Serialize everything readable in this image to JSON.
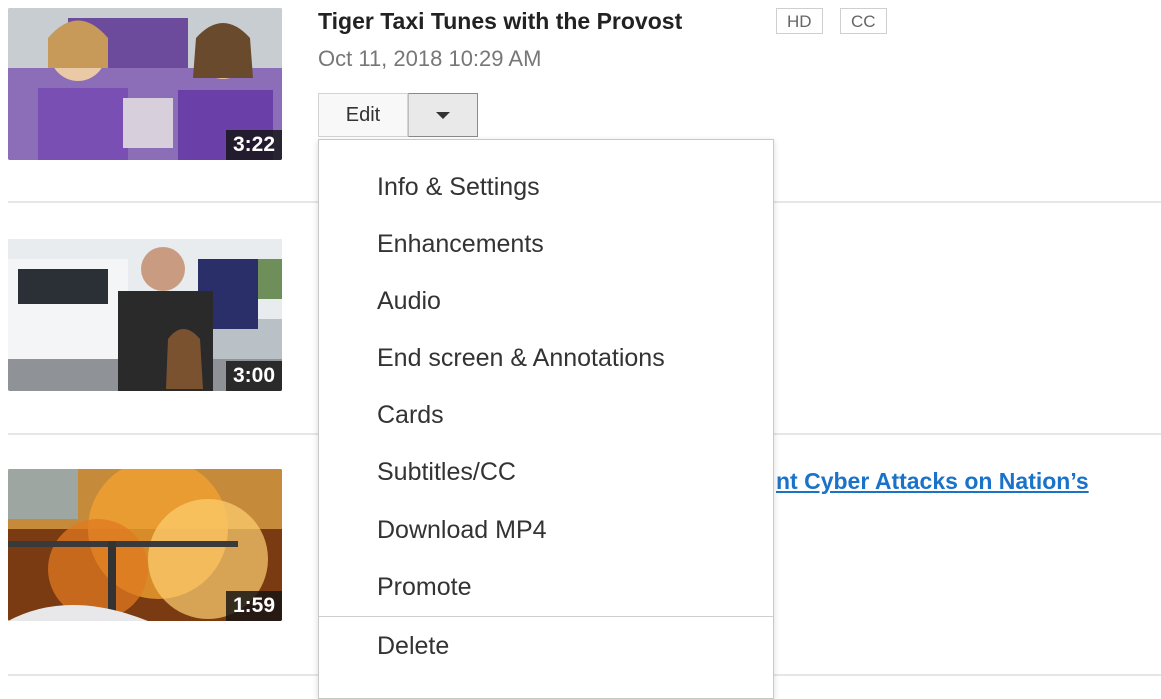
{
  "videos": [
    {
      "title": "Tiger Taxi Tunes with the Provost",
      "badges": [
        "HD",
        "CC"
      ],
      "date": "Oct 11, 2018 10:29 AM",
      "duration": "3:22"
    },
    {
      "duration": "3:00"
    },
    {
      "title_fragment": "nt Cyber Attacks on Nation’s",
      "duration": "1:59"
    }
  ],
  "edit": {
    "label": "Edit",
    "dropdown_icon": "chevron-down-icon"
  },
  "menu": {
    "items": [
      "Info & Settings",
      "Enhancements",
      "Audio",
      "End screen & Annotations",
      "Cards",
      "Subtitles/CC",
      "Download MP4",
      "Promote"
    ],
    "delete_label": "Delete"
  },
  "colors": {
    "link": "#1a73c9",
    "duration_bg": "#141414",
    "divider": "#e6e6e6"
  }
}
